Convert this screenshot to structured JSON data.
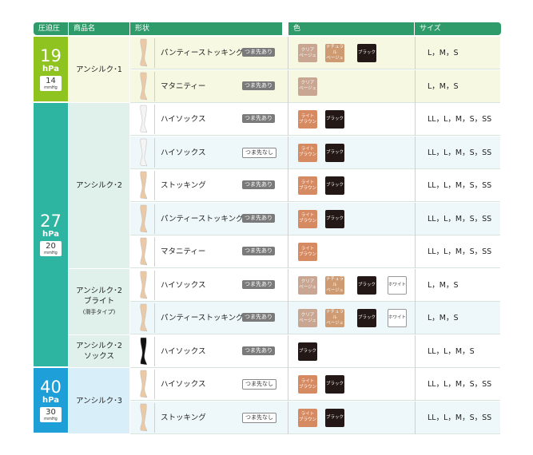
{
  "headers": [
    "圧迫圧",
    "商品名",
    "形状",
    "色",
    "サイズ"
  ],
  "groups": [
    {
      "pressure": "19",
      "unit": "hPa",
      "mmhg": "14",
      "mmhg_unit": "mmHg",
      "color": "#8fc31f"
    },
    {
      "pressure": "27",
      "unit": "hPa",
      "mmhg": "20",
      "mmhg_unit": "mmHg",
      "color": "#2eb5a1"
    },
    {
      "pressure": "40",
      "unit": "hPa",
      "mmhg": "30",
      "mmhg_unit": "mmHg",
      "color": "#1e9fd8"
    }
  ],
  "products": [
    {
      "name": "アンシルク･1",
      "sub": ""
    },
    {
      "name": "アンシルク･2",
      "sub": ""
    },
    {
      "name": "アンシルク･2\nブライト",
      "sub": "(滑手タイプ)"
    },
    {
      "name": "アンシルク･2\nソックス",
      "sub": ""
    },
    {
      "name": "アンシルク･3",
      "sub": ""
    }
  ],
  "swatch_labels": {
    "clear": "クリア\nベージュ",
    "natural": "ナチュラル\nベージュ",
    "black": "ブラック",
    "light": "ライト\nブラウン",
    "white": "ホワイト"
  },
  "toe_labels": {
    "ari": "つま先あり",
    "nashi": "つま先なし"
  },
  "rows": [
    {
      "shape": "パンティーストッキング",
      "toe": "ari",
      "colors": [
        "clear",
        "natural",
        "black"
      ],
      "size": "L，M，S"
    },
    {
      "shape": "マタニティー",
      "toe": "ari",
      "colors": [
        "clear"
      ],
      "size": "L，M，S"
    },
    {
      "shape": "ハイソックス",
      "toe": "ari",
      "colors": [
        "light",
        "black"
      ],
      "size": "LL，L，M，S，SS"
    },
    {
      "shape": "ハイソックス",
      "toe": "nashi",
      "colors": [
        "light",
        "black"
      ],
      "size": "LL，L，M，S，SS"
    },
    {
      "shape": "ストッキング",
      "toe": "ari",
      "colors": [
        "light",
        "black"
      ],
      "size": "LL，L，M，S，SS"
    },
    {
      "shape": "パンティーストッキング",
      "toe": "ari",
      "colors": [
        "light",
        "black"
      ],
      "size": "LL，L，M，S，SS"
    },
    {
      "shape": "マタニティー",
      "toe": "ari",
      "colors": [
        "light"
      ],
      "size": "LL，L，M，S，SS"
    },
    {
      "shape": "ハイソックス",
      "toe": "ari",
      "colors": [
        "clear",
        "natural",
        "black",
        "white"
      ],
      "size": "L，M，S"
    },
    {
      "shape": "パンティーストッキング",
      "toe": "ari",
      "colors": [
        "clear",
        "natural",
        "black",
        "white"
      ],
      "size": "L，M，S"
    },
    {
      "shape": "ハイソックス",
      "toe": "ari",
      "colors": [
        "black"
      ],
      "size": "LL，L，M，S"
    },
    {
      "shape": "ハイソックス",
      "toe": "nashi",
      "colors": [
        "light",
        "black"
      ],
      "size": "LL，L，M，S，SS"
    },
    {
      "shape": "ストッキング",
      "toe": "nashi",
      "colors": [
        "light",
        "black"
      ],
      "size": "LL，L，M，S，SS"
    }
  ]
}
